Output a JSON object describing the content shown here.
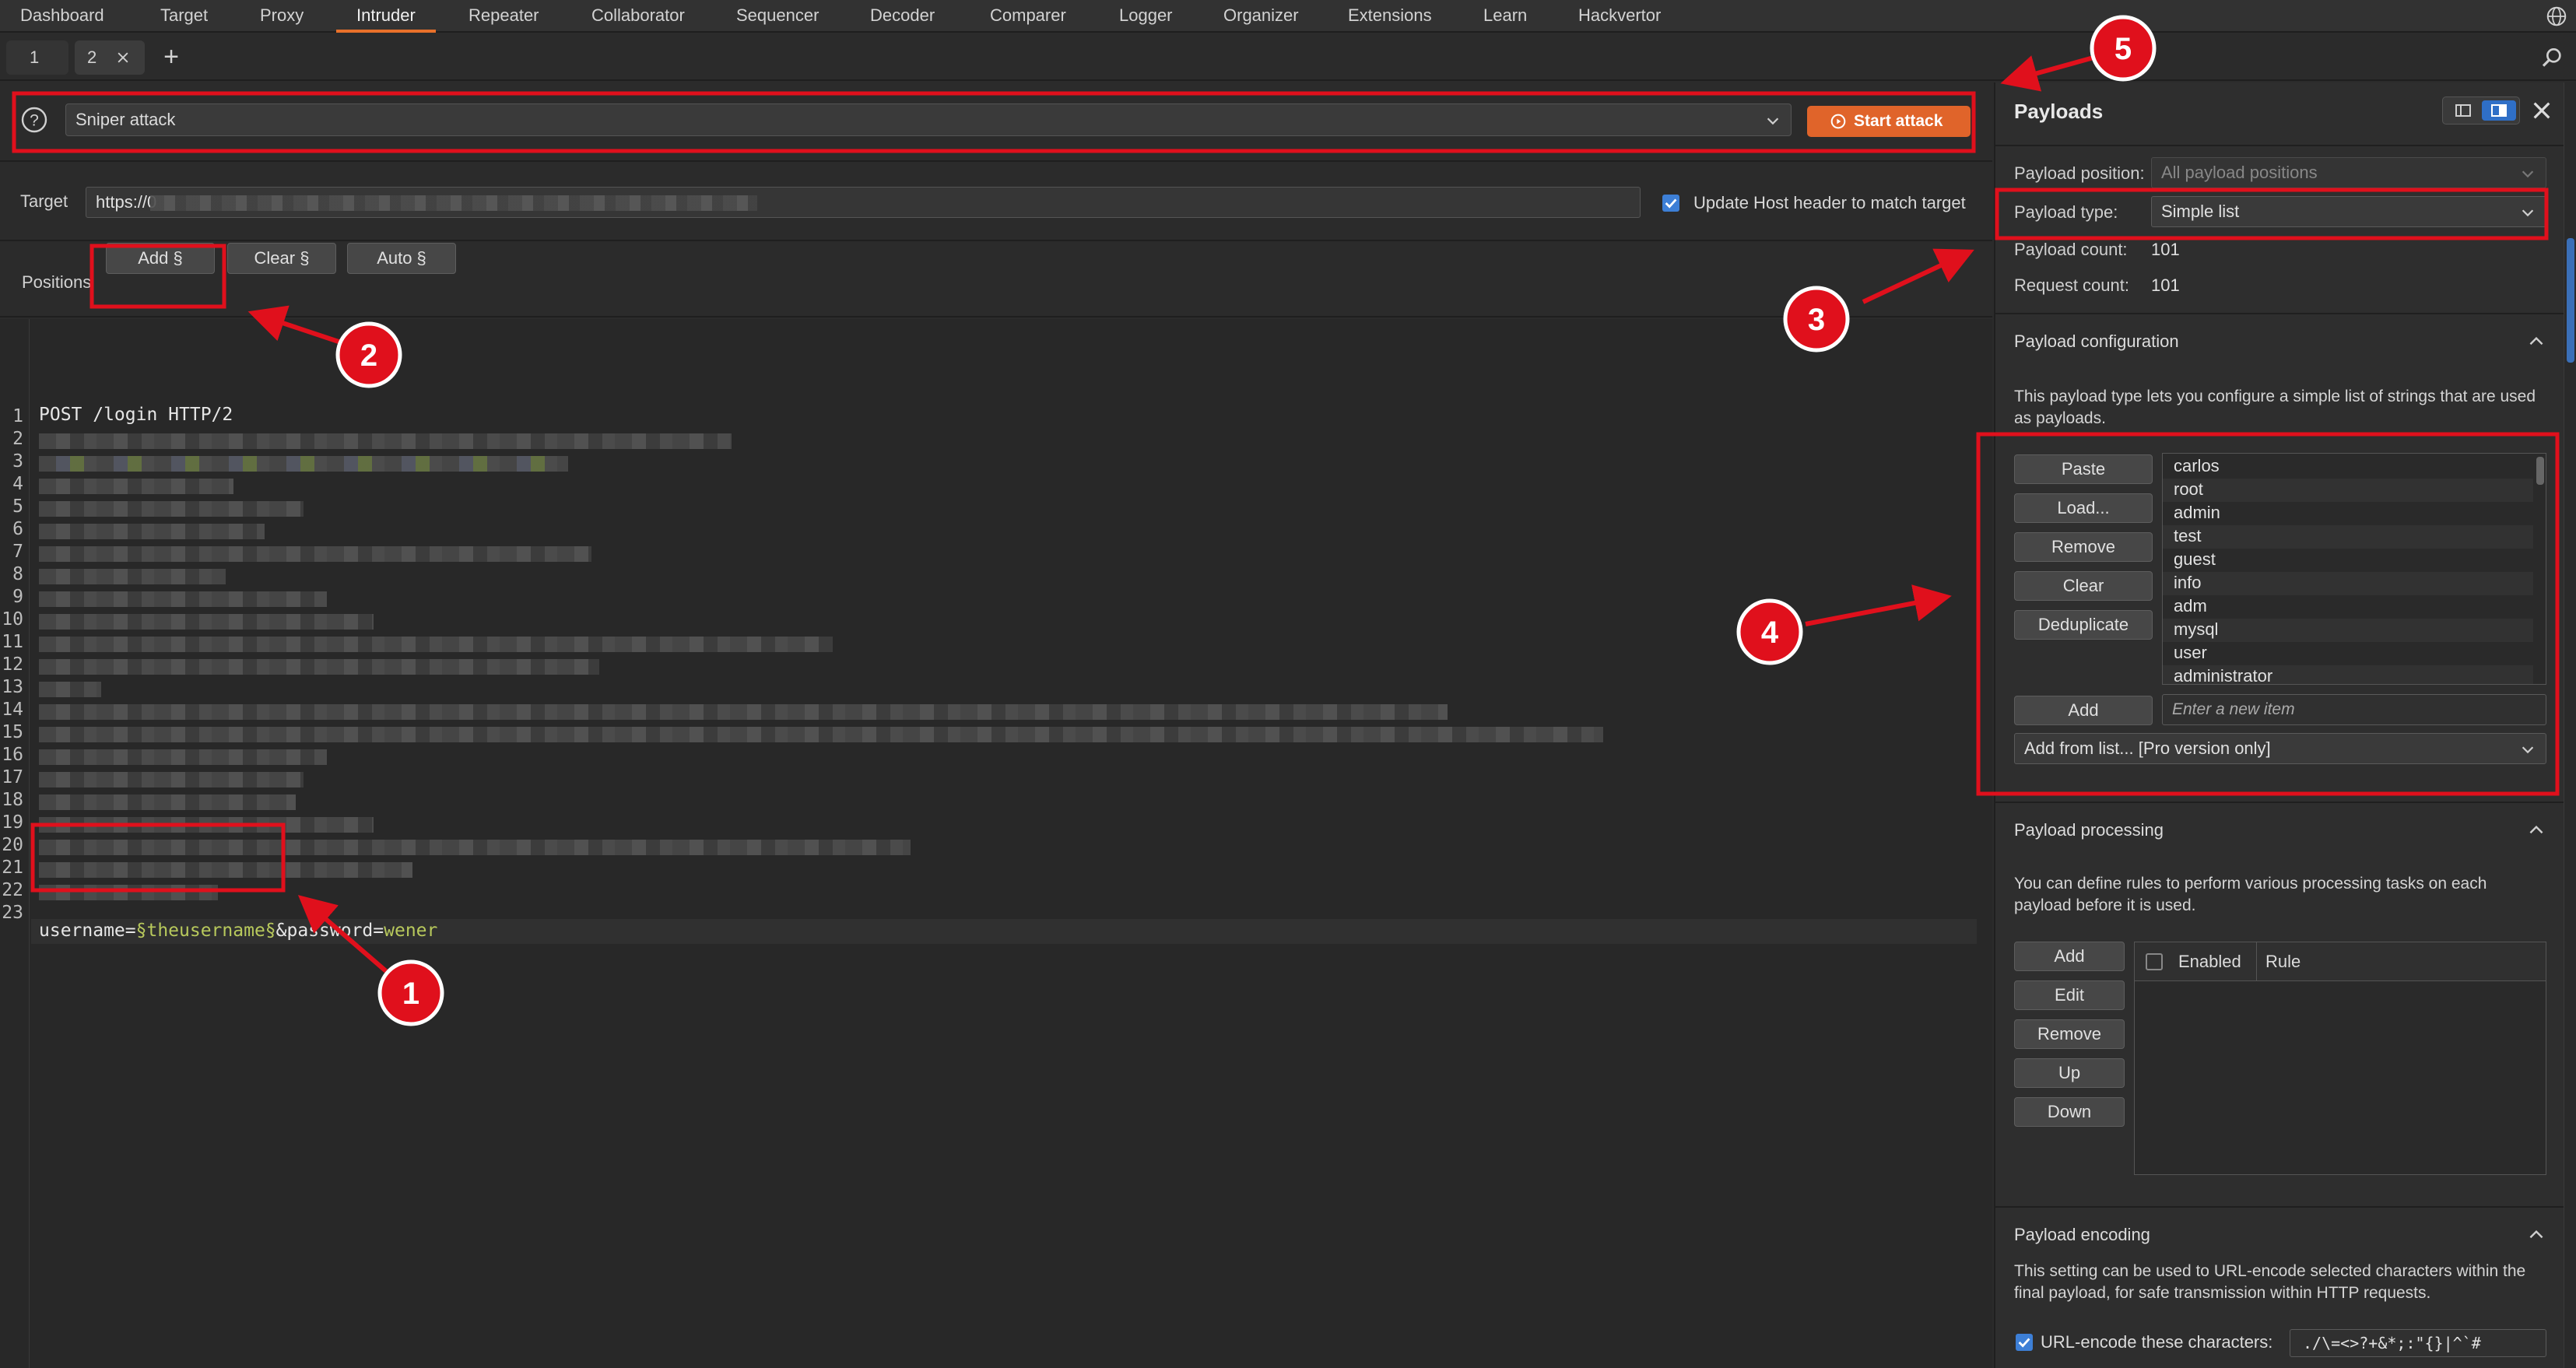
{
  "menu": {
    "tabs": [
      "Dashboard",
      "Target",
      "Proxy",
      "Intruder",
      "Repeater",
      "Collaborator",
      "Sequencer",
      "Decoder",
      "Comparer",
      "Logger",
      "Organizer",
      "Extensions",
      "Learn",
      "Hackvertor"
    ],
    "active": "Intruder"
  },
  "subtabs": {
    "tab1": "1",
    "tab2": "2"
  },
  "attack": {
    "type": "Sniper attack",
    "start_label": "Start attack"
  },
  "target": {
    "label": "Target",
    "value": "https://0",
    "update_host_label": "Update Host header to match target",
    "update_host_checked": true
  },
  "positions": {
    "label": "Positions",
    "add": "Add §",
    "clear": "Clear §",
    "auto": "Auto §"
  },
  "editor": {
    "line_numbers": [
      "1",
      "2",
      "3",
      "4",
      "5",
      "6",
      "7",
      "8",
      "9",
      "10",
      "11",
      "12",
      "13",
      "14",
      "15",
      "16",
      "17",
      "18",
      "19",
      "20",
      "21",
      "22",
      "23"
    ],
    "line1": "POST /login HTTP/2",
    "line23": {
      "p1": "username=",
      "p2": "§theusername§",
      "p3": "&password=",
      "p4": "wener"
    }
  },
  "payloads": {
    "title": "Payloads",
    "position_label": "Payload position:",
    "position_value": "All payload positions",
    "type_label": "Payload type:",
    "type_value": "Simple list",
    "count_label": "Payload count:",
    "count_value": "101",
    "request_label": "Request count:",
    "request_value": "101",
    "config": {
      "title": "Payload configuration",
      "desc": "This payload type lets you configure a simple list of strings that are used as payloads.",
      "buttons": [
        "Paste",
        "Load...",
        "Remove",
        "Clear",
        "Deduplicate"
      ],
      "items": [
        "carlos",
        "root",
        "admin",
        "test",
        "guest",
        "info",
        "adm",
        "mysql",
        "user",
        "administrator"
      ],
      "add_button": "Add",
      "add_placeholder": "Enter a new item",
      "add_from_list": "Add from list... [Pro version only]"
    },
    "processing": {
      "title": "Payload processing",
      "desc": "You can define rules to perform various processing tasks on each payload before it is used.",
      "buttons": [
        "Add",
        "Edit",
        "Remove",
        "Up",
        "Down"
      ],
      "col_enabled": "Enabled",
      "col_rule": "Rule"
    },
    "encoding": {
      "title": "Payload encoding",
      "desc": "This setting can be used to URL-encode selected characters within the final payload, for safe transmission within HTTP requests.",
      "check_label": "URL-encode these characters:",
      "chars": "./\\=<>?+&*;:\"{}|^`#"
    }
  },
  "annotations": [
    "1",
    "2",
    "3",
    "4",
    "5"
  ],
  "colors": {
    "accent": "#e8702a",
    "annotation": "#e0101c",
    "start_button": "#e0642a",
    "param": "#b8c95c"
  }
}
